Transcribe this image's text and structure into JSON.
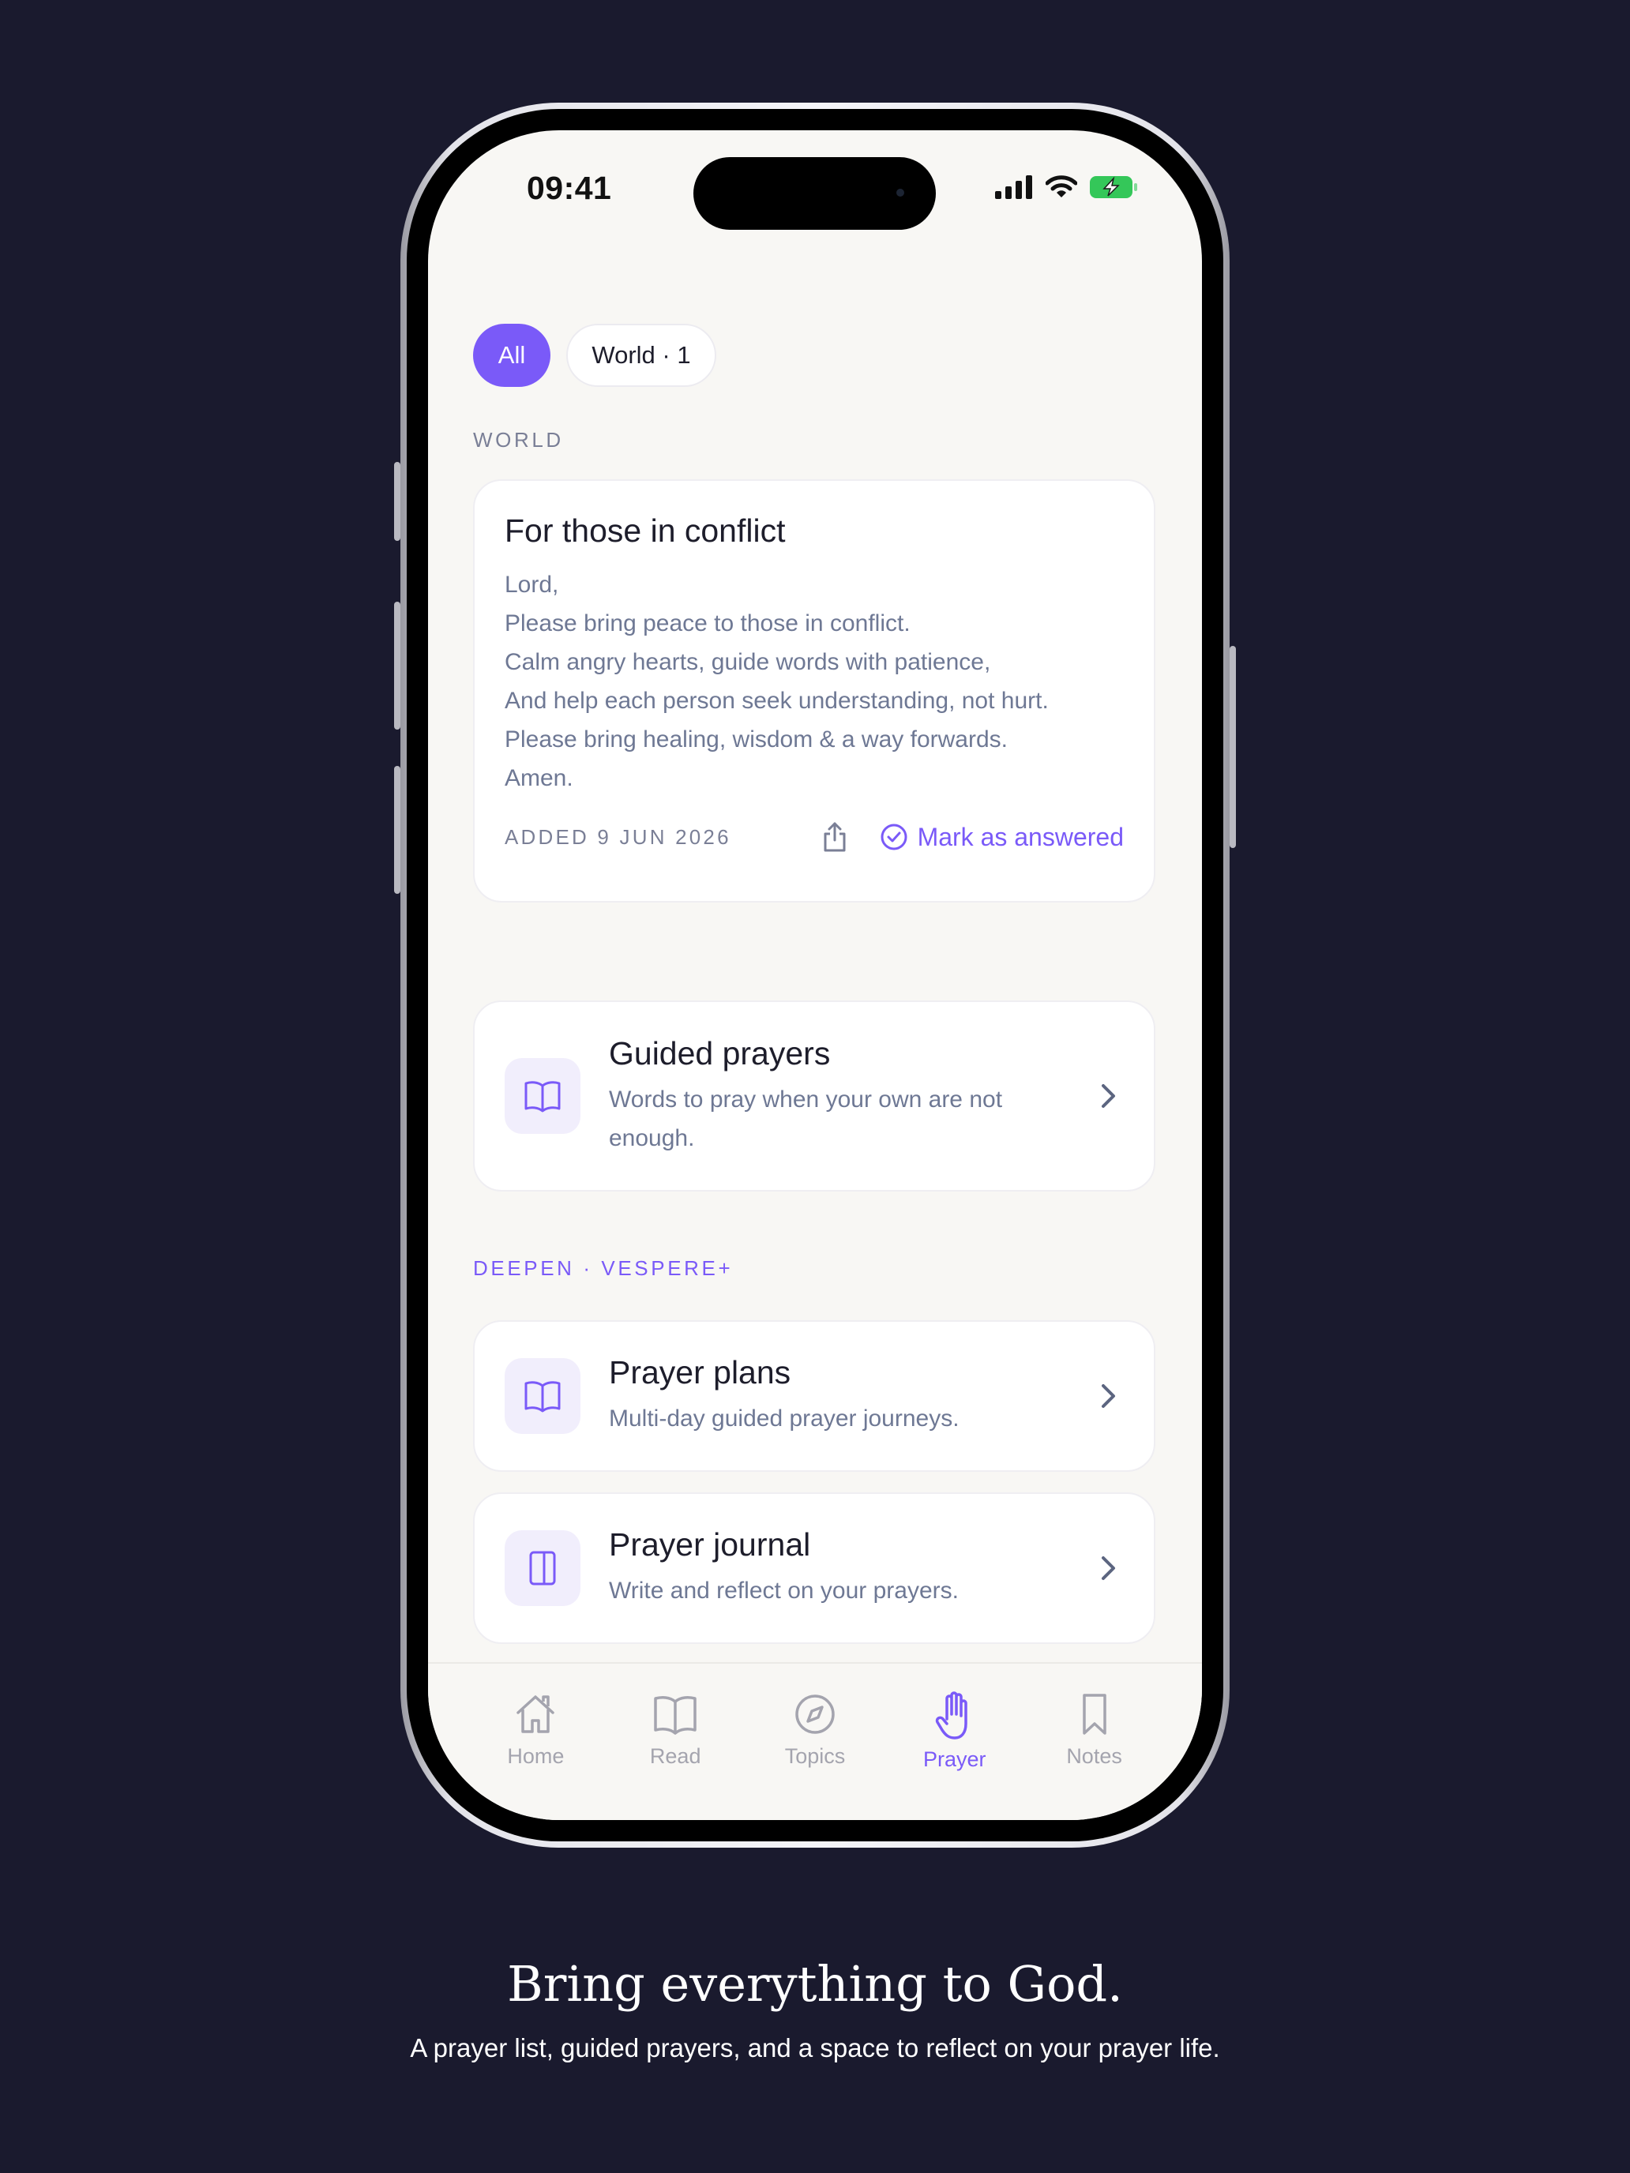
{
  "status": {
    "time": "09:41"
  },
  "filters": [
    {
      "label": "All",
      "active": true
    },
    {
      "label": "World · 1",
      "active": false
    }
  ],
  "world_section": {
    "label": "WORLD",
    "prayer": {
      "title": "For those in conflict",
      "lines": [
        "Lord,",
        "Please bring peace to those in conflict.",
        "Calm angry hearts, guide words with patience,",
        "And help each person seek understanding, not hurt.",
        "Please bring healing, wisdom & a way forwards.",
        "Amen."
      ],
      "added": "ADDED 9 JUN 2026",
      "answer_label": "Mark as answered"
    }
  },
  "guided": {
    "title": "Guided prayers",
    "subtitle_line1": "Words to pray when your own are not",
    "subtitle_line2": "enough.",
    "icon": "open-book-icon"
  },
  "deepen_section": {
    "label": "DEEPEN · VESPERE+",
    "items": [
      {
        "title": "Prayer plans",
        "subtitle": "Multi-day guided prayer journeys.",
        "icon": "open-book-icon"
      },
      {
        "title": "Prayer journal",
        "subtitle": "Write and reflect on your prayers.",
        "icon": "journal-icon"
      }
    ]
  },
  "tabs": [
    {
      "label": "Home",
      "icon": "home-icon",
      "active": false
    },
    {
      "label": "Read",
      "icon": "book-icon",
      "active": false
    },
    {
      "label": "Topics",
      "icon": "compass-icon",
      "active": false
    },
    {
      "label": "Prayer",
      "icon": "praying-hand-icon",
      "active": true
    },
    {
      "label": "Notes",
      "icon": "bookmark-icon",
      "active": false
    }
  ],
  "caption": {
    "title": "Bring everything to God.",
    "subtitle": "A prayer list, guided prayers, and a space to reflect on your prayer life."
  },
  "colors": {
    "background": "#1a1a2e",
    "accent": "#7a5af8",
    "screen": "#f8f7f4",
    "muted_text": "#6e7894",
    "battery": "#34c759"
  }
}
